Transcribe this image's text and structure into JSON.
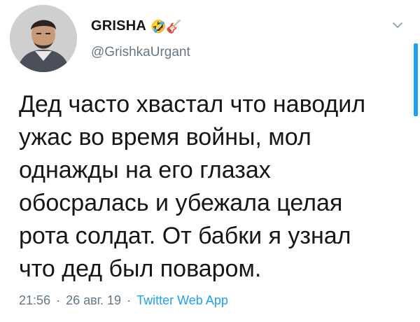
{
  "author": {
    "name": "GRISHA",
    "name_emoji": "🤣🎸",
    "handle": "@GrishkaUrgant"
  },
  "tweet": {
    "lines": [
      "Дед часто хвастал что наводил",
      "ужас во время войны, мол",
      "однажды на его глазах",
      "обосралась и убежала целая",
      "рота солдат. От бабки я узнал",
      "что дед был поваром."
    ]
  },
  "meta": {
    "time": "21:56",
    "date": "26 авг. 19",
    "source": "Twitter Web App",
    "separator": "·"
  },
  "icons": {
    "menu": "chevron-down-icon",
    "avatar": "avatar"
  },
  "colors": {
    "text": "#14171a",
    "secondary": "#657786",
    "accent": "#1da1f2"
  }
}
